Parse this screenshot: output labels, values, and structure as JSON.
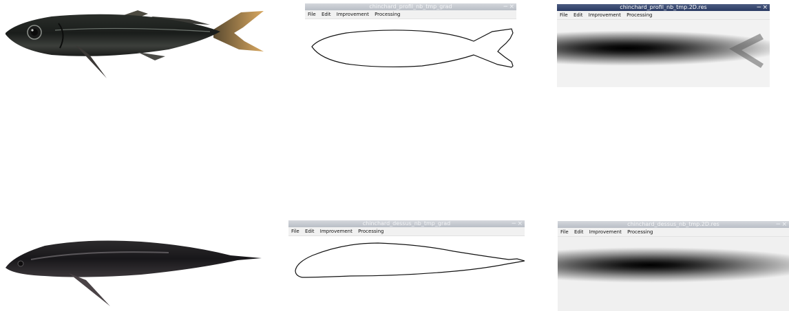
{
  "colors": {
    "titlebar_active": "#2e3e66",
    "titlebar_inactive": "#c6cad1",
    "menubar_bg": "#f1f1f1",
    "outline": "#111111",
    "distance_map_dark": "#000000",
    "distance_map_light": "#ffffff"
  },
  "top_row": {
    "photo": {
      "subject": "fish-profile-photo"
    },
    "gradient_window": {
      "title": "chinchard_profil_nb_tmp_grad",
      "menu": [
        "File",
        "Edit",
        "Improvement",
        "Processing"
      ],
      "controls": {
        "minimize": "−",
        "close": "×"
      }
    },
    "distance_window": {
      "title": "chinchard_profil_nb_tmp.2D.res",
      "menu": [
        "File",
        "Edit",
        "Improvement",
        "Processing"
      ],
      "controls": {
        "minimize": "−",
        "close": "×"
      }
    }
  },
  "bottom_row": {
    "photo": {
      "subject": "fish-dorsal-photo"
    },
    "gradient_window": {
      "title": "chinchard_dessus_nb_tmp_grad",
      "menu": [
        "File",
        "Edit",
        "Improvement",
        "Processing"
      ],
      "controls": {
        "minimize": "−",
        "close": "×"
      }
    },
    "distance_window": {
      "title": "chinchard_dessus_nb_tmp.2D.res",
      "menu": [
        "File",
        "Edit",
        "Improvement",
        "Processing"
      ],
      "controls": {
        "minimize": "−",
        "close": "×"
      }
    }
  }
}
